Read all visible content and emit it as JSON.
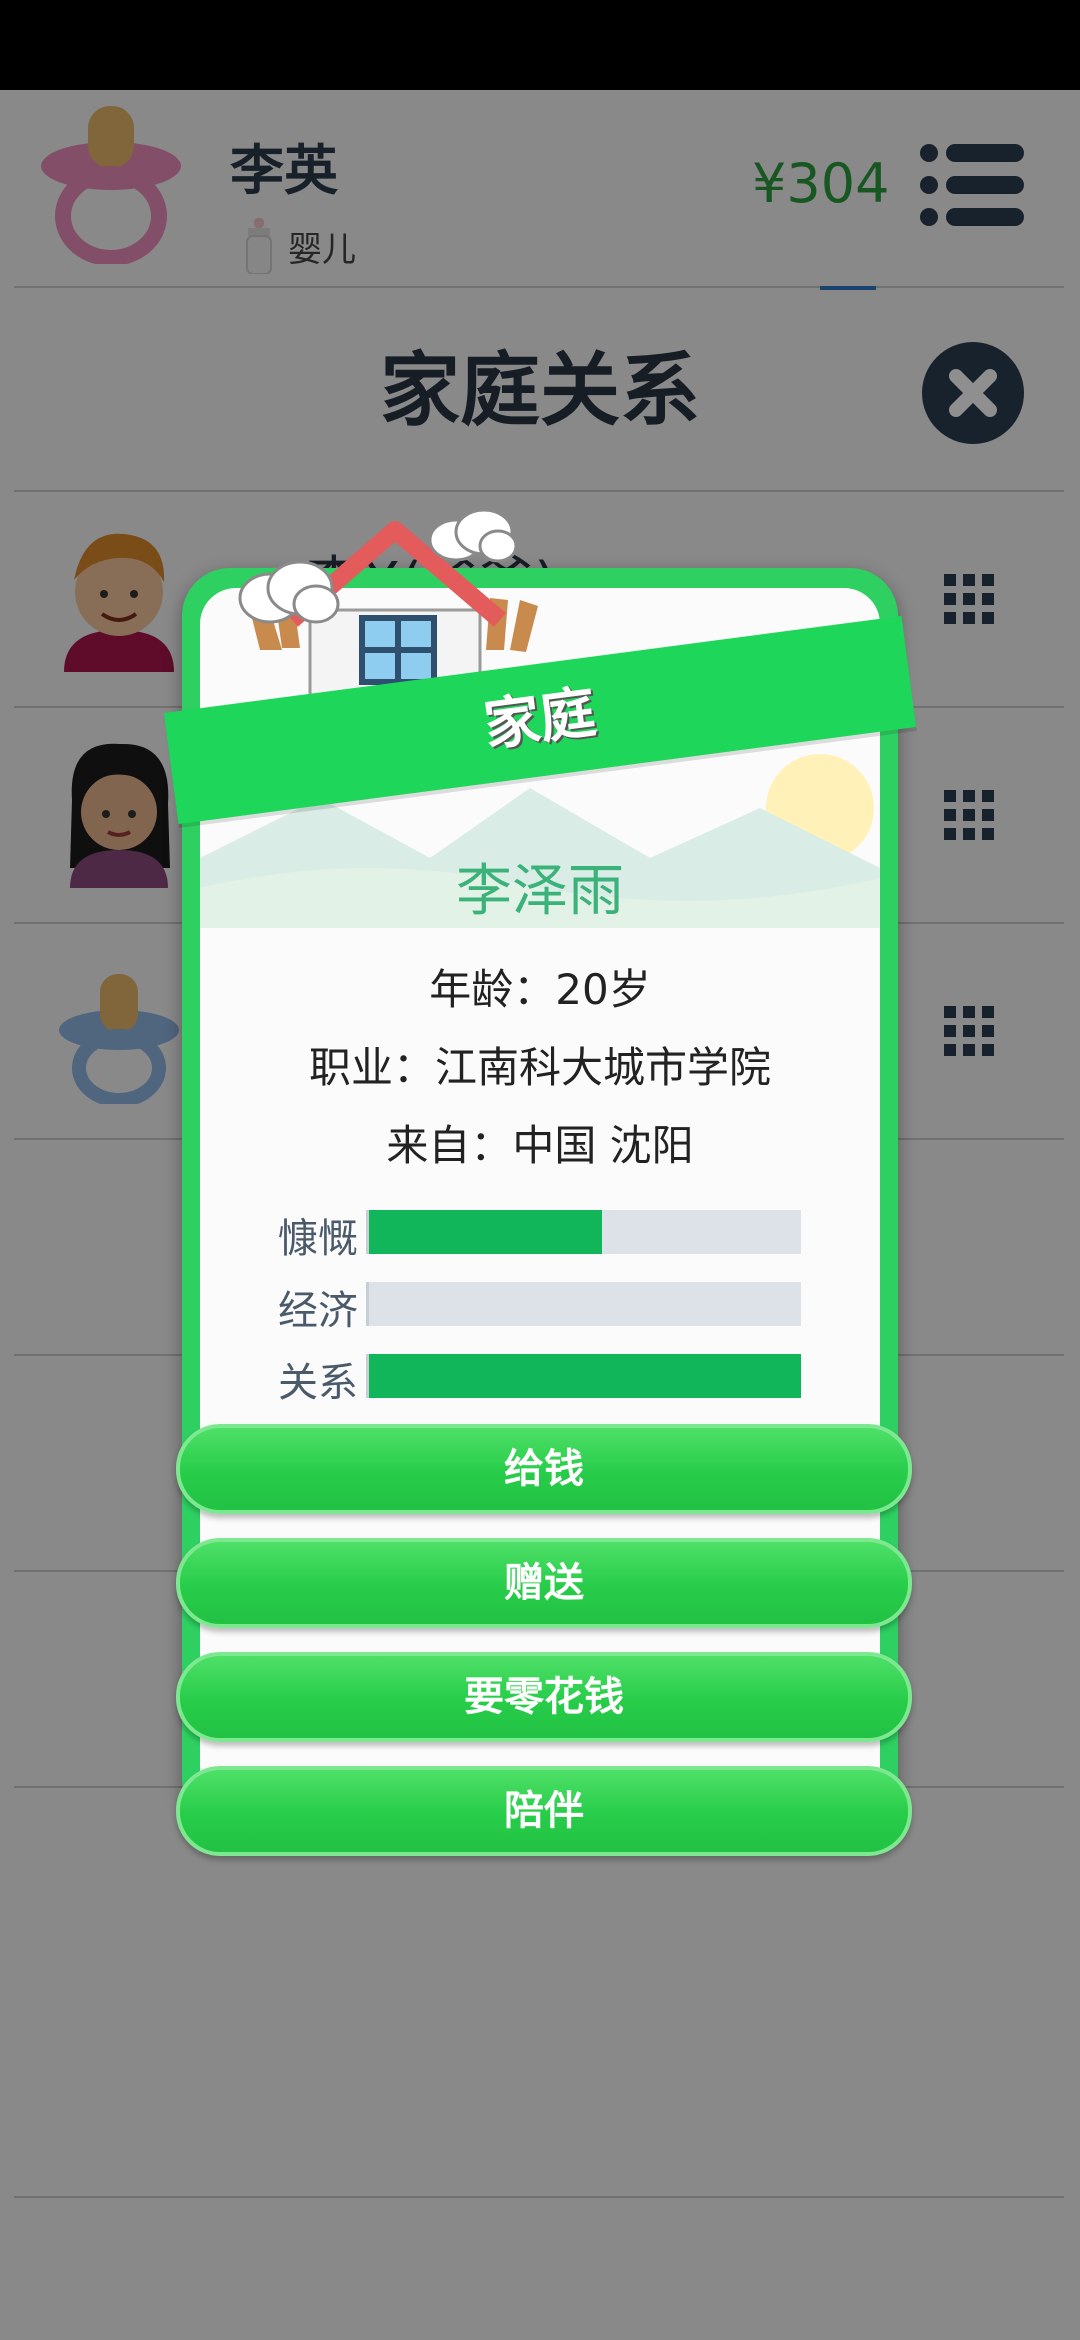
{
  "header": {
    "player_name": "李英",
    "stage": "婴儿",
    "money": "¥304"
  },
  "page": {
    "title": "家庭关系",
    "members": [
      {
        "name": "李X(爸爸)"
      },
      {
        "name": ""
      },
      {
        "name": ""
      }
    ]
  },
  "modal": {
    "banner": "家庭",
    "name": "李泽雨",
    "age_line": "年龄：20岁",
    "job_line": "职业：江南科大城市学院",
    "from_line": "来自：中国 沈阳",
    "stats": [
      {
        "label": "慷慨",
        "value": 0.54
      },
      {
        "label": "经济",
        "value": 0.0
      },
      {
        "label": "关系",
        "value": 1.0
      }
    ],
    "buttons": [
      "给钱",
      "赠送",
      "要零花钱",
      "陪伴"
    ]
  },
  "colors": {
    "accent_green": "#2ed161",
    "stat_fill": "#12b65a",
    "money_green": "#2e9b3e"
  }
}
